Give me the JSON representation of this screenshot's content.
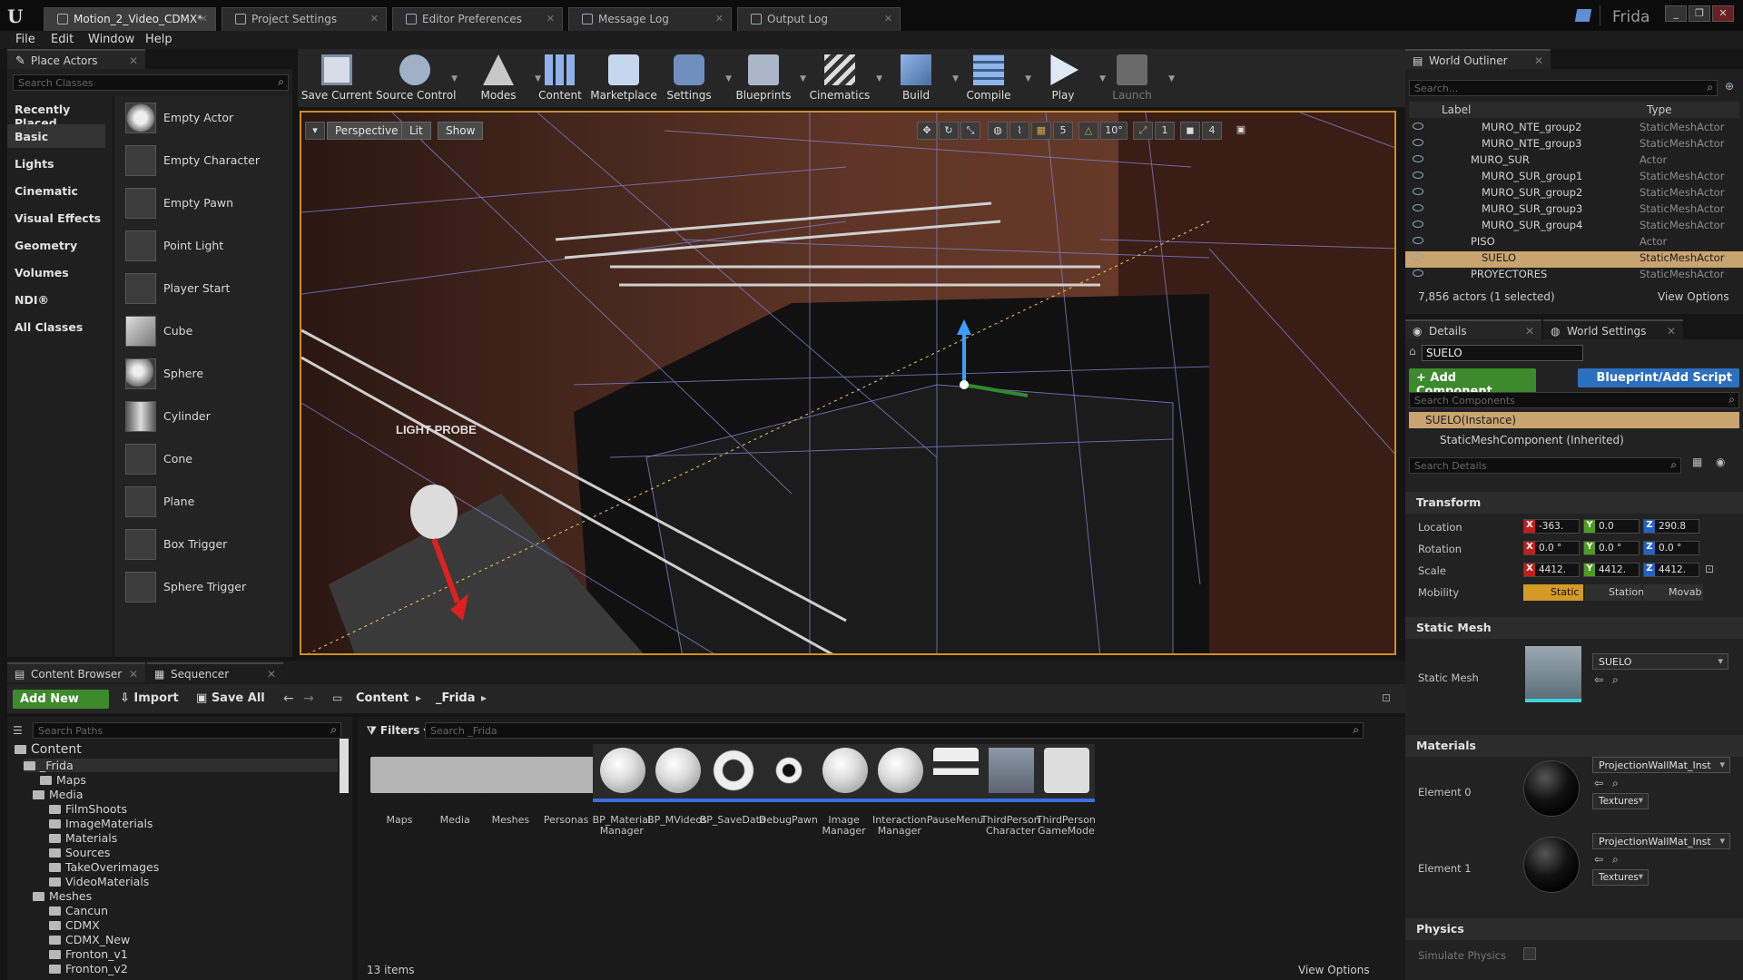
{
  "window": {
    "tabs": [
      {
        "label": "Motion_2_Video_CDMX*"
      },
      {
        "label": "Project Settings"
      },
      {
        "label": "Editor Preferences"
      },
      {
        "label": "Message Log"
      },
      {
        "label": "Output Log"
      }
    ],
    "user": "Frida"
  },
  "menu": [
    "File",
    "Edit",
    "Window",
    "Help"
  ],
  "place_actors": {
    "title": "Place Actors",
    "search_placeholder": "Search Classes",
    "categories": [
      "Recently Placed",
      "Basic",
      "Lights",
      "Cinematic",
      "Visual Effects",
      "Geometry",
      "Volumes",
      "NDI®",
      "All Classes"
    ],
    "selected_category": "Basic",
    "items": [
      "Empty Actor",
      "Empty Character",
      "Empty Pawn",
      "Point Light",
      "Player Start",
      "Cube",
      "Sphere",
      "Cylinder",
      "Cone",
      "Plane",
      "Box Trigger",
      "Sphere Trigger"
    ]
  },
  "toolbar": {
    "buttons": [
      {
        "label": "Save Current",
        "icon": "save-icon"
      },
      {
        "label": "Source Control",
        "icon": "source-control-icon"
      },
      {
        "label": "Modes",
        "icon": "modes-icon"
      },
      {
        "label": "Content",
        "icon": "content-icon"
      },
      {
        "label": "Marketplace",
        "icon": "marketplace-icon"
      },
      {
        "label": "Settings",
        "icon": "settings-icon"
      },
      {
        "label": "Blueprints",
        "icon": "blueprints-icon"
      },
      {
        "label": "Cinematics",
        "icon": "cinematics-icon"
      },
      {
        "label": "Build",
        "icon": "build-icon"
      },
      {
        "label": "Compile",
        "icon": "compile-icon"
      },
      {
        "label": "Play",
        "icon": "play-icon"
      },
      {
        "label": "Launch",
        "icon": "launch-icon"
      }
    ]
  },
  "viewport": {
    "perspective": "Perspective",
    "lit": "Lit",
    "show": "Show",
    "grid_snap": "5",
    "rot_snap": "10°",
    "scale_snap": "1",
    "cam_speed": "4",
    "probe_label": "LIGHT PROBE"
  },
  "outliner": {
    "title": "World Outliner",
    "search_placeholder": "Search...",
    "col_label": "Label",
    "col_type": "Type",
    "rows": [
      {
        "label": "MURO_NTE_group2",
        "type": "StaticMeshActor"
      },
      {
        "label": "MURO_NTE_group3",
        "type": "StaticMeshActor"
      },
      {
        "label": "MURO_SUR",
        "type": "Actor"
      },
      {
        "label": "MURO_SUR_group1",
        "type": "StaticMeshActor"
      },
      {
        "label": "MURO_SUR_group2",
        "type": "StaticMeshActor"
      },
      {
        "label": "MURO_SUR_group3",
        "type": "StaticMeshActor"
      },
      {
        "label": "MURO_SUR_group4",
        "type": "StaticMeshActor"
      },
      {
        "label": "PISO",
        "type": "Actor"
      },
      {
        "label": "SUELO",
        "type": "StaticMeshActor"
      },
      {
        "label": "PROYECTORES",
        "type": "StaticMeshActor"
      }
    ],
    "count": "7,856 actors (1 selected)",
    "view_options": "View Options"
  },
  "details": {
    "tab_details": "Details",
    "tab_world": "World Settings",
    "name": "SUELO",
    "add_component": "+ Add Component",
    "blueprint": "Blueprint/Add Script",
    "search_components": "Search Components",
    "instance": "SUELO(Instance)",
    "component": "StaticMeshComponent (Inherited)",
    "search_details": "Search Details",
    "transform": "Transform",
    "location_label": "Location",
    "rotation_label": "Rotation",
    "scale_label": "Scale",
    "mobility_label": "Mobility",
    "location": [
      "-363.",
      "0.0",
      "290.8"
    ],
    "rotation": [
      "0.0 °",
      "0.0 °",
      "0.0 °"
    ],
    "scale": [
      "4412.",
      "4412.",
      "4412."
    ],
    "mobility": [
      "Static",
      "Station",
      "Movab"
    ],
    "static_mesh_section": "Static Mesh",
    "static_mesh_label": "Static Mesh",
    "static_mesh_value": "SUELO",
    "materials_section": "Materials",
    "element0": "Element 0",
    "element1": "Element 1",
    "mat0": "ProjectionWallMat_Inst",
    "mat1": "ProjectionWallMat_Inst",
    "textures": "Textures",
    "physics": "Physics",
    "simulate_physics": "Simulate Physics"
  },
  "content_browser": {
    "tab": "Content Browser",
    "tab2": "Sequencer",
    "add_new": "Add New",
    "import": "Import",
    "save_all": "Save All",
    "crumb1": "Content",
    "crumb2": "_Frida",
    "search_paths": "Search Paths",
    "filters": "Filters",
    "search_assets": "Search _Frida",
    "tree": [
      "Content",
      "_Frida",
      "Maps",
      "Media",
      "FilmShoots",
      "ImageMaterials",
      "Materials",
      "Sources",
      "TakeOverimages",
      "VideoMaterials",
      "Meshes",
      "Cancun",
      "CDMX",
      "CDMX_New",
      "Fronton_v1",
      "Fronton_v2"
    ],
    "assets": [
      {
        "name": "Maps"
      },
      {
        "name": "Media"
      },
      {
        "name": "Meshes"
      },
      {
        "name": "Personas"
      },
      {
        "name": "BP_Material Manager"
      },
      {
        "name": "BP_MVideos"
      },
      {
        "name": "BP_SaveData"
      },
      {
        "name": "DebugPawn"
      },
      {
        "name": "Image Manager"
      },
      {
        "name": "Interaction Manager"
      },
      {
        "name": "PauseMenu"
      },
      {
        "name": "ThirdPerson Character"
      },
      {
        "name": "ThirdPerson GameMode"
      }
    ],
    "item_count": "13 items",
    "view_options": "View Options"
  }
}
